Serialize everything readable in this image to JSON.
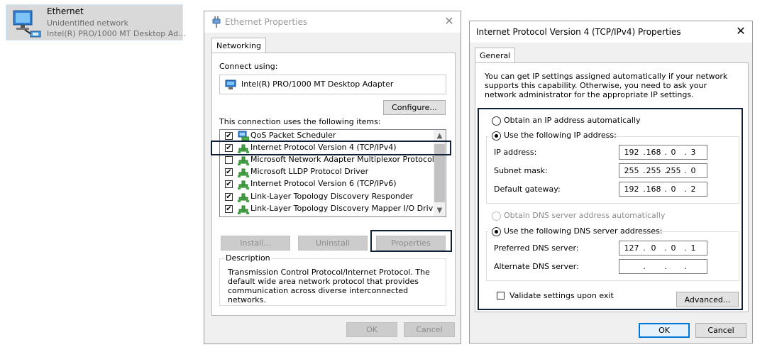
{
  "adapter": {
    "name": "Ethernet",
    "status": "Unidentified network",
    "device": "Intel(R) PRO/1000 MT Desktop Ad..."
  },
  "eth_dialog": {
    "title": "Ethernet Properties",
    "close": "✕",
    "tab": "Networking",
    "connect_using_label": "Connect using:",
    "adapter_name": "Intel(R) PRO/1000 MT Desktop Adapter",
    "configure_button": "Configure...",
    "items_label": "This connection uses the following items:",
    "items": [
      {
        "label": "QoS Packet Scheduler",
        "checked": true,
        "icon": "scheduler-icon"
      },
      {
        "label": "Internet Protocol Version 4 (TCP/IPv4)",
        "checked": true,
        "icon": "protocol-icon"
      },
      {
        "label": "Microsoft Network Adapter Multiplexor Protocol",
        "checked": false,
        "icon": "protocol-icon"
      },
      {
        "label": "Microsoft LLDP Protocol Driver",
        "checked": true,
        "icon": "protocol-icon"
      },
      {
        "label": "Internet Protocol Version 6 (TCP/IPv6)",
        "checked": true,
        "icon": "protocol-icon"
      },
      {
        "label": "Link-Layer Topology Discovery Responder",
        "checked": true,
        "icon": "protocol-icon"
      },
      {
        "label": "Link-Layer Topology Discovery Mapper I/O Driver",
        "checked": true,
        "icon": "protocol-icon"
      }
    ],
    "install_button": "Install...",
    "uninstall_button": "Uninstall",
    "properties_button": "Properties",
    "description_legend": "Description",
    "description_text": "Transmission Control Protocol/Internet Protocol. The default wide area network protocol that provides communication across diverse interconnected networks.",
    "ok_button": "OK",
    "cancel_button": "Cancel"
  },
  "ipv4_dialog": {
    "title": "Internet Protocol Version 4 (TCP/IPv4) Properties",
    "close": "✕",
    "tab": "General",
    "intro": "You can get IP settings assigned automatically if your network supports this capability. Otherwise, you need to ask your network administrator for the appropriate IP settings.",
    "obtain_ip_auto": "Obtain an IP address automatically",
    "use_following_ip": "Use the following IP address:",
    "ip_address_label": "IP address:",
    "ip_address": [
      "192",
      "168",
      "0",
      "3"
    ],
    "subnet_mask_label": "Subnet mask:",
    "subnet_mask": [
      "255",
      "255",
      "255",
      "0"
    ],
    "default_gateway_label": "Default gateway:",
    "default_gateway": [
      "192",
      "168",
      "0",
      "2"
    ],
    "obtain_dns_auto": "Obtain DNS server address automatically",
    "use_following_dns": "Use the following DNS server addresses:",
    "preferred_dns_label": "Preferred DNS server:",
    "preferred_dns": [
      "127",
      "0",
      "0",
      "1"
    ],
    "alternate_dns_label": "Alternate DNS server:",
    "alternate_dns": [
      "",
      "",
      "",
      ""
    ],
    "validate_label": "Validate settings upon exit",
    "advanced_button": "Advanced...",
    "ok_button": "OK",
    "cancel_button": "Cancel"
  }
}
